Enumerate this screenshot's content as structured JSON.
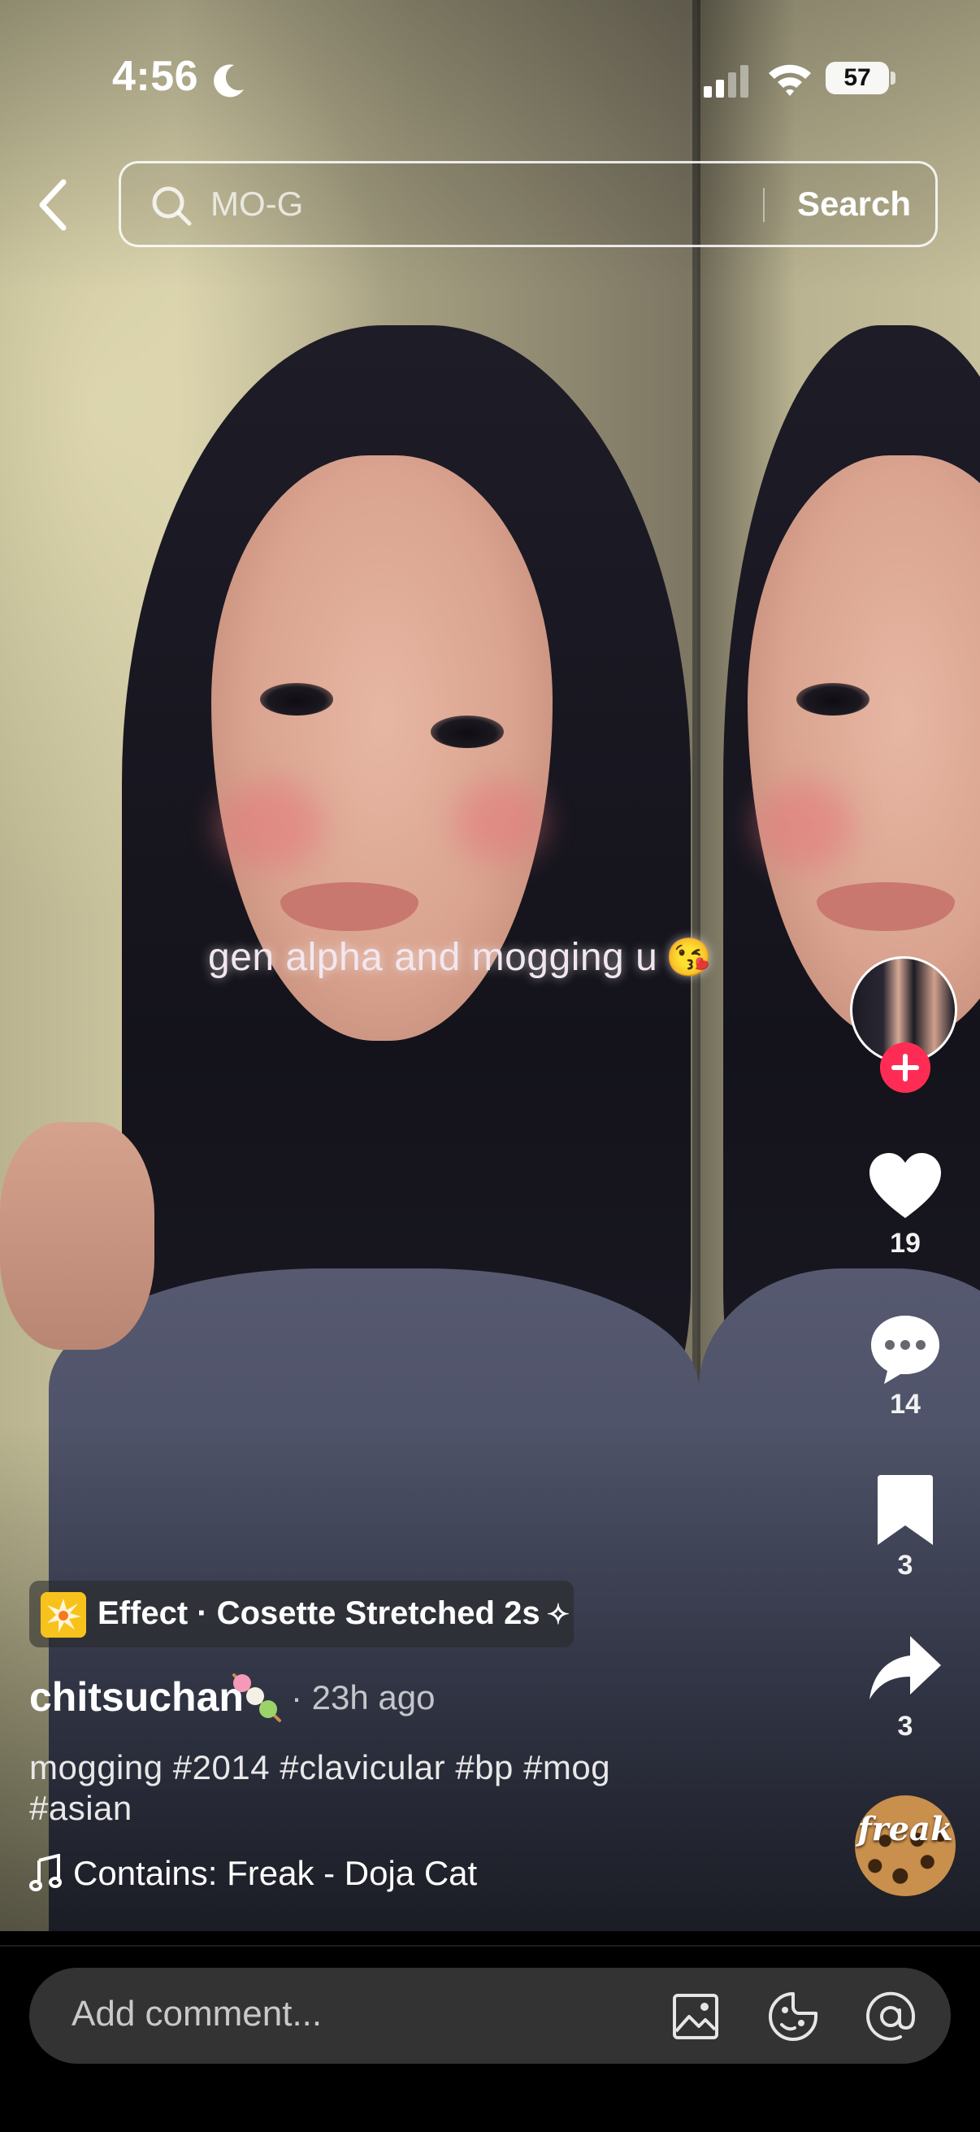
{
  "status_bar": {
    "time": "4:56",
    "battery": "57",
    "icons": [
      "moon-icon",
      "cellular-signal-icon",
      "wifi-icon",
      "battery-icon"
    ]
  },
  "search": {
    "query": "MO-G",
    "button_label": "Search"
  },
  "video": {
    "overlay_text": "gen alpha and mogging u",
    "overlay_emoji": "😘"
  },
  "actions": {
    "likes": "19",
    "comments": "14",
    "saves": "3",
    "shares": "3",
    "icons": [
      "heart-icon",
      "comment-icon",
      "bookmark-icon",
      "share-icon",
      "plus-icon"
    ]
  },
  "effect": {
    "label": "Effect · Cosette Stretched 2s",
    "sparkle": "✧"
  },
  "post": {
    "username": "chitsuchan",
    "username_emoji": "🍡",
    "time": "· 23h ago",
    "caption_line1": "mogging  #2014 #clavicular #bp #mog",
    "caption_line2": "#asian",
    "music": "Contains: Freak - Doja Cat",
    "disc_label": "freak"
  },
  "comment": {
    "placeholder": "Add comment...",
    "icons": [
      "image-icon",
      "sticker-icon",
      "mention-icon"
    ]
  },
  "colors": {
    "accent": "#fe2c55",
    "effect_icon": "#f8c21c",
    "comment_field": "#333333"
  }
}
